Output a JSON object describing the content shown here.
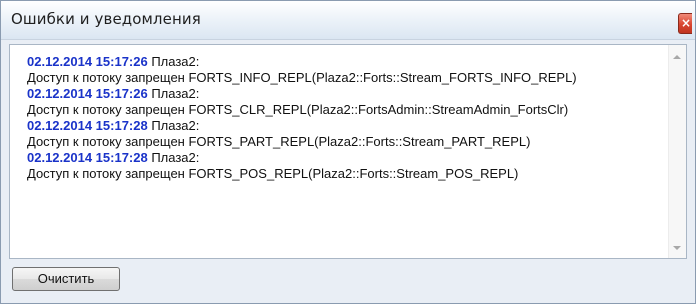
{
  "window": {
    "title": "Ошибки и уведомления",
    "close_icon": "close-icon"
  },
  "log": {
    "entries": [
      {
        "timestamp": "02.12.2014 15:17:26",
        "source": " Плаза2:",
        "message": "Доступ к потоку запрещен FORTS_INFO_REPL(Plaza2::Forts::Stream_FORTS_INFO_REPL)"
      },
      {
        "timestamp": "02.12.2014 15:17:26",
        "source": " Плаза2:",
        "message": "Доступ к потоку запрещен FORTS_CLR_REPL(Plaza2::FortsAdmin::StreamAdmin_FortsClr)"
      },
      {
        "timestamp": "02.12.2014 15:17:28",
        "source": " Плаза2:",
        "message": "Доступ к потоку запрещен FORTS_PART_REPL(Plaza2::Forts::Stream_PART_REPL)"
      },
      {
        "timestamp": "02.12.2014 15:17:28",
        "source": " Плаза2:",
        "message": "Доступ к потоку запрещен FORTS_POS_REPL(Plaza2::Forts::Stream_POS_REPL)"
      }
    ]
  },
  "footer": {
    "clear_label": "Очистить"
  },
  "colors": {
    "timestamp": "#1a33c9",
    "close_button": "#d9452f"
  }
}
